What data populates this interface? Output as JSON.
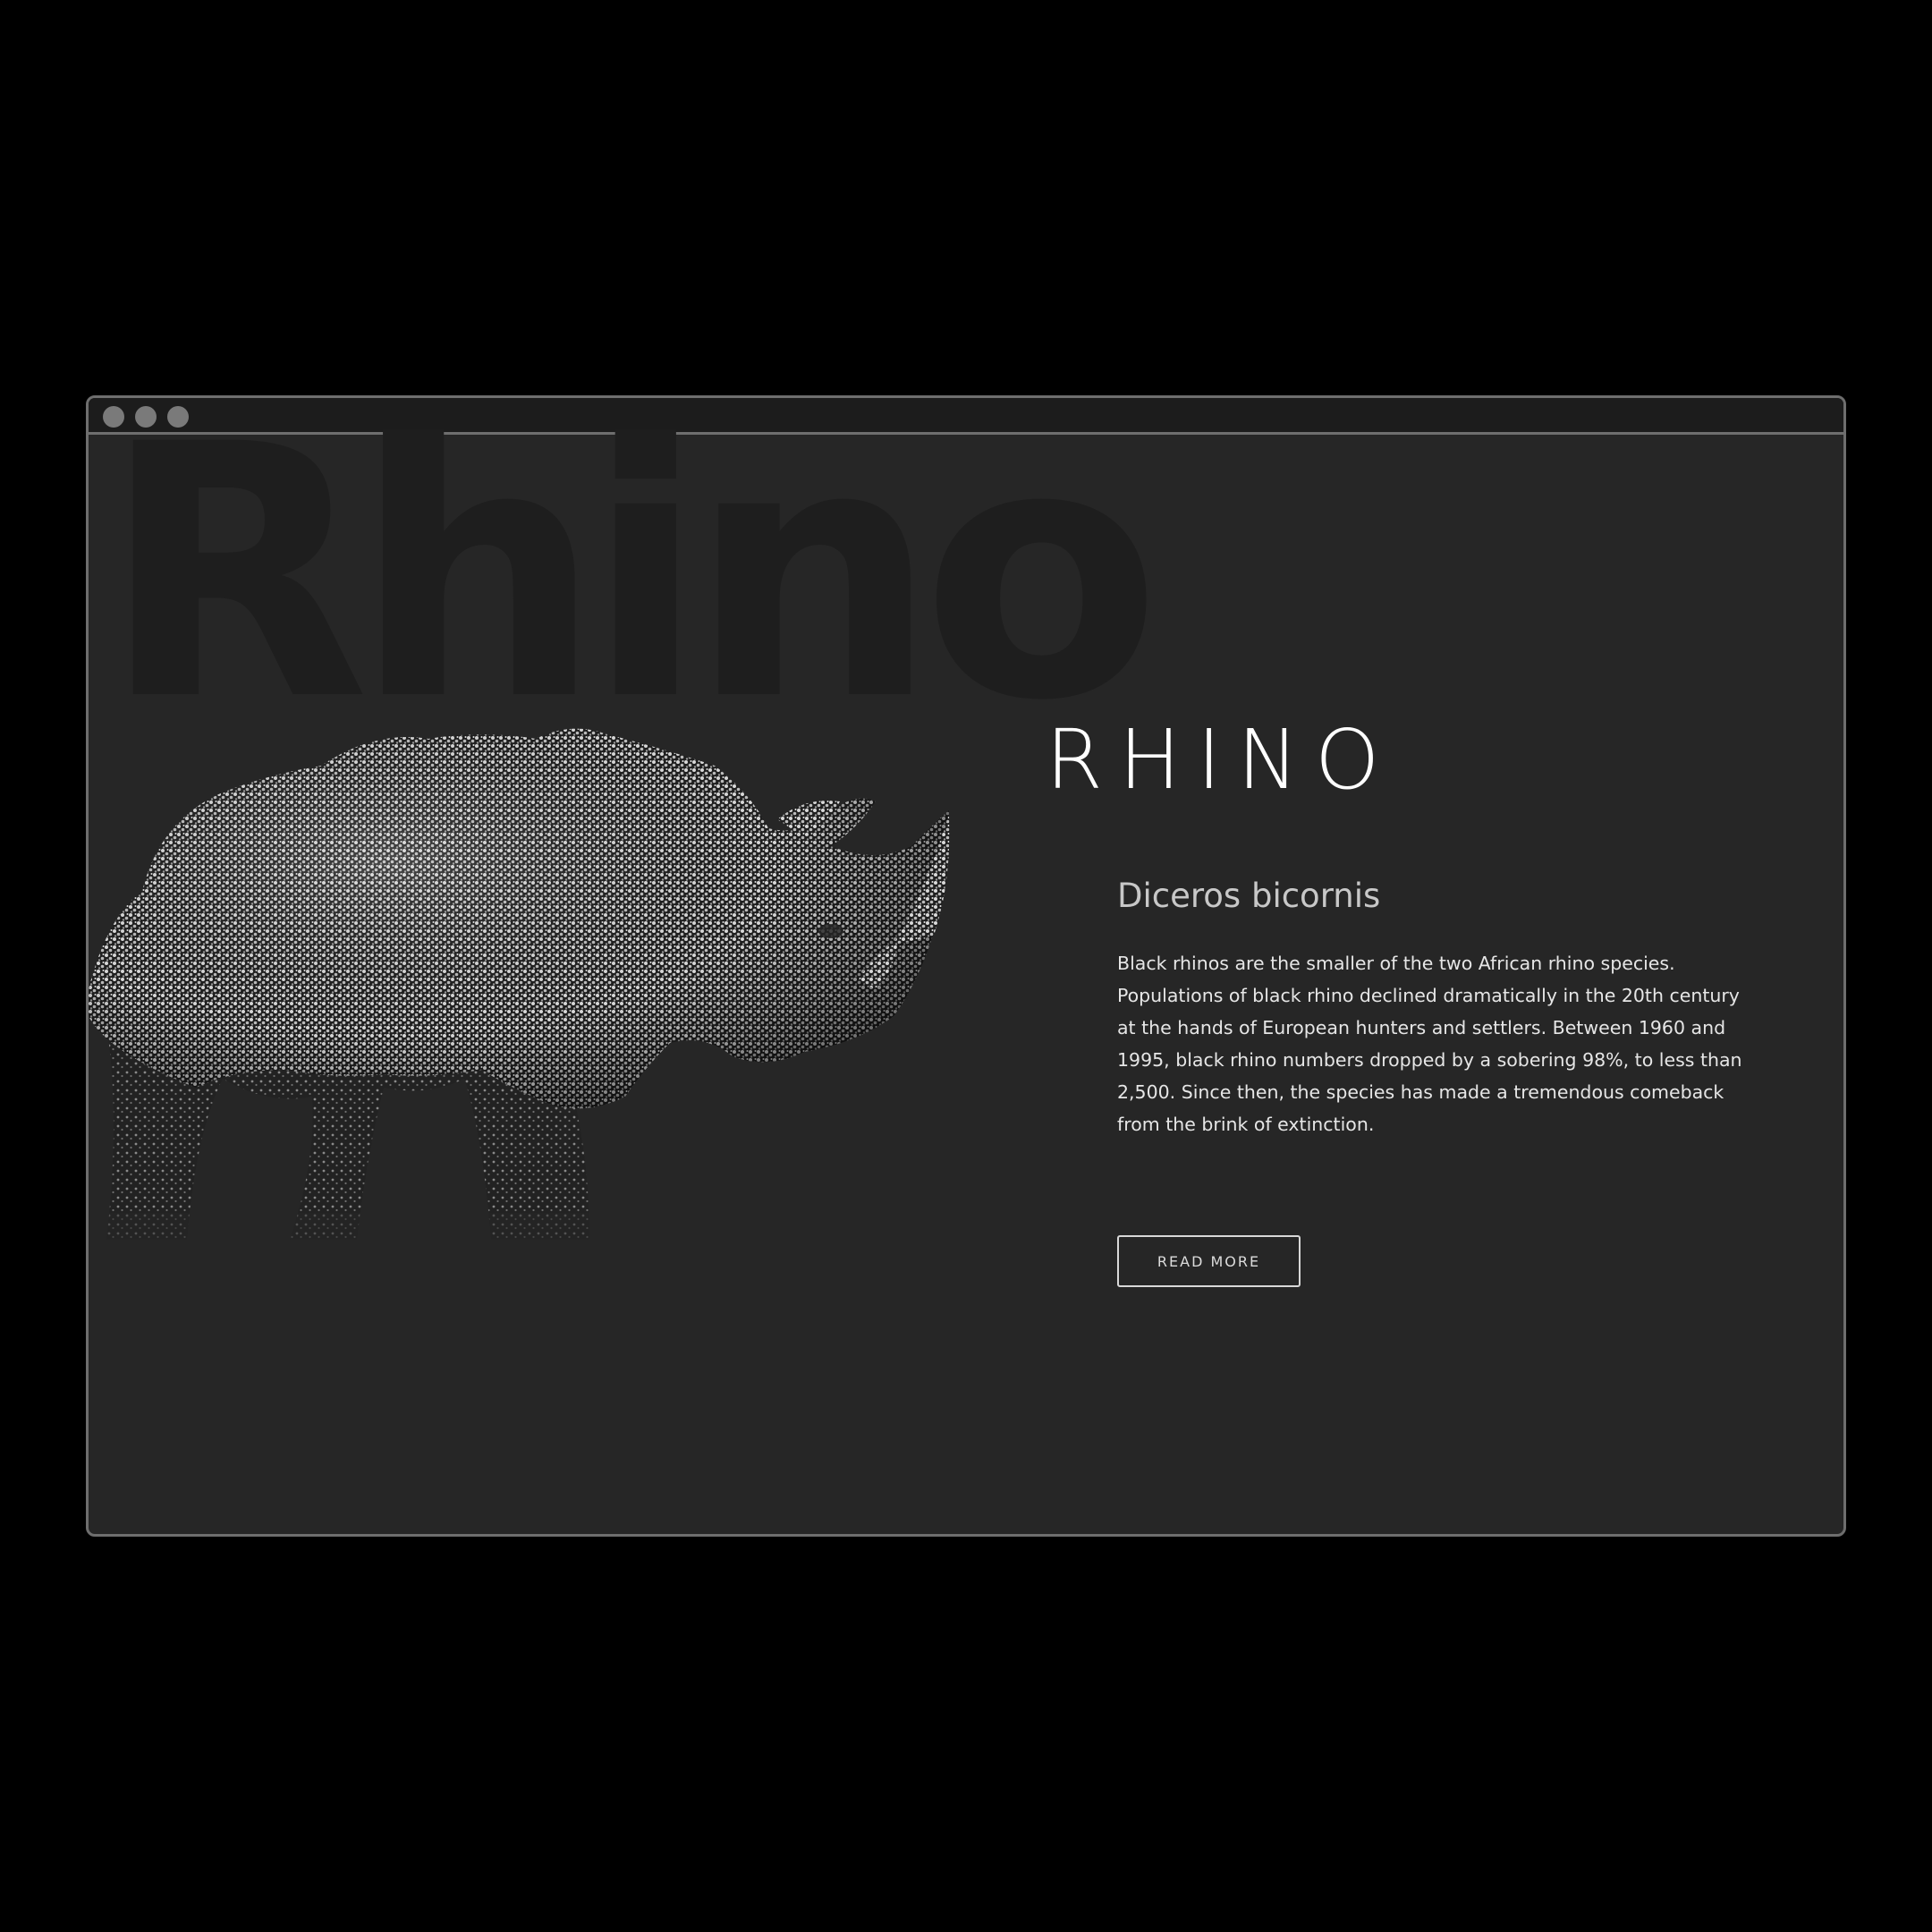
{
  "window": {
    "controls": [
      "close",
      "minimize",
      "maximize"
    ]
  },
  "hero": {
    "watermark": "Rhino",
    "title": "RHINO",
    "subtitle": "Diceros bicornis",
    "description": "Black rhinos are the smaller of the two African rhino species. Populations of black rhino declined dramatically in the 20th century at the hands of European hunters and settlers. Between 1960 and 1995, black rhino numbers dropped by a sobering 98%, to less than 2,500. Since then, the species has made a tremendous comeback from the brink of extinction.",
    "button_label": "READ MORE",
    "image": "rhino-stipple-illustration"
  },
  "colors": {
    "page_background": "#000000",
    "window_background": "#262626",
    "window_border": "#6e6e6e",
    "title": "#ffffff",
    "subtitle": "#c8c8c8",
    "body_text": "#e6e6e6",
    "watermark": "#1e1e1e"
  }
}
